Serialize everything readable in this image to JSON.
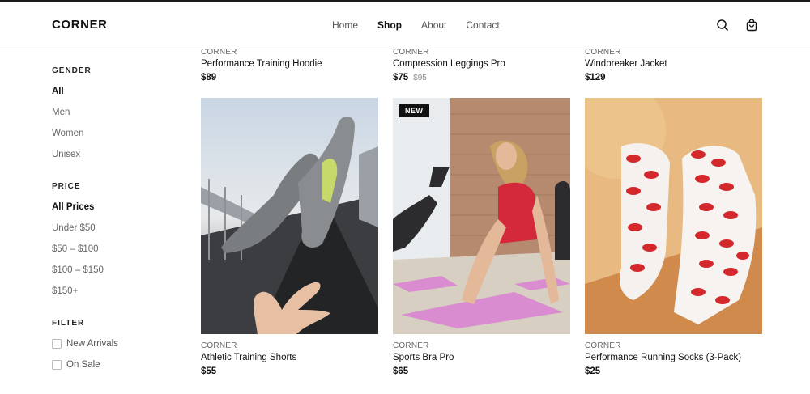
{
  "header": {
    "logo": "CORNER",
    "nav": [
      "Home",
      "Shop",
      "About",
      "Contact"
    ],
    "active_nav": "Shop",
    "search_icon": "search-icon",
    "cart_icon": "shopping-bag-icon"
  },
  "sidebar": {
    "gender": {
      "title": "GENDER",
      "options": [
        "All",
        "Men",
        "Women",
        "Unisex"
      ],
      "selected": "All"
    },
    "price": {
      "title": "PRICE",
      "options": [
        "All Prices",
        "Under $50",
        "$50 – $100",
        "$100 – $150",
        "$150+"
      ],
      "selected": "All Prices"
    },
    "filter": {
      "title": "FILTER",
      "checkboxes": [
        {
          "label": "New Arrivals",
          "checked": false
        },
        {
          "label": "On Sale",
          "checked": false
        }
      ]
    }
  },
  "products_top": [
    {
      "brand": "CORNER",
      "name": "Performance Training Hoodie",
      "price": "$89",
      "old_price": ""
    },
    {
      "brand": "CORNER",
      "name": "Compression Leggings Pro",
      "price": "$75",
      "old_price": "$95"
    },
    {
      "brand": "CORNER",
      "name": "Windbreaker Jacket",
      "price": "$129",
      "old_price": ""
    }
  ],
  "products_bottom": [
    {
      "brand": "CORNER",
      "name": "Athletic Training Shorts",
      "price": "$55",
      "badge": ""
    },
    {
      "brand": "CORNER",
      "name": "Sports Bra Pro",
      "price": "$65",
      "badge": "NEW"
    },
    {
      "brand": "CORNER",
      "name": "Performance Running Socks (3-Pack)",
      "price": "$25",
      "badge": ""
    }
  ],
  "colors": {
    "accent": "#111111",
    "muted_text": "#666666"
  }
}
